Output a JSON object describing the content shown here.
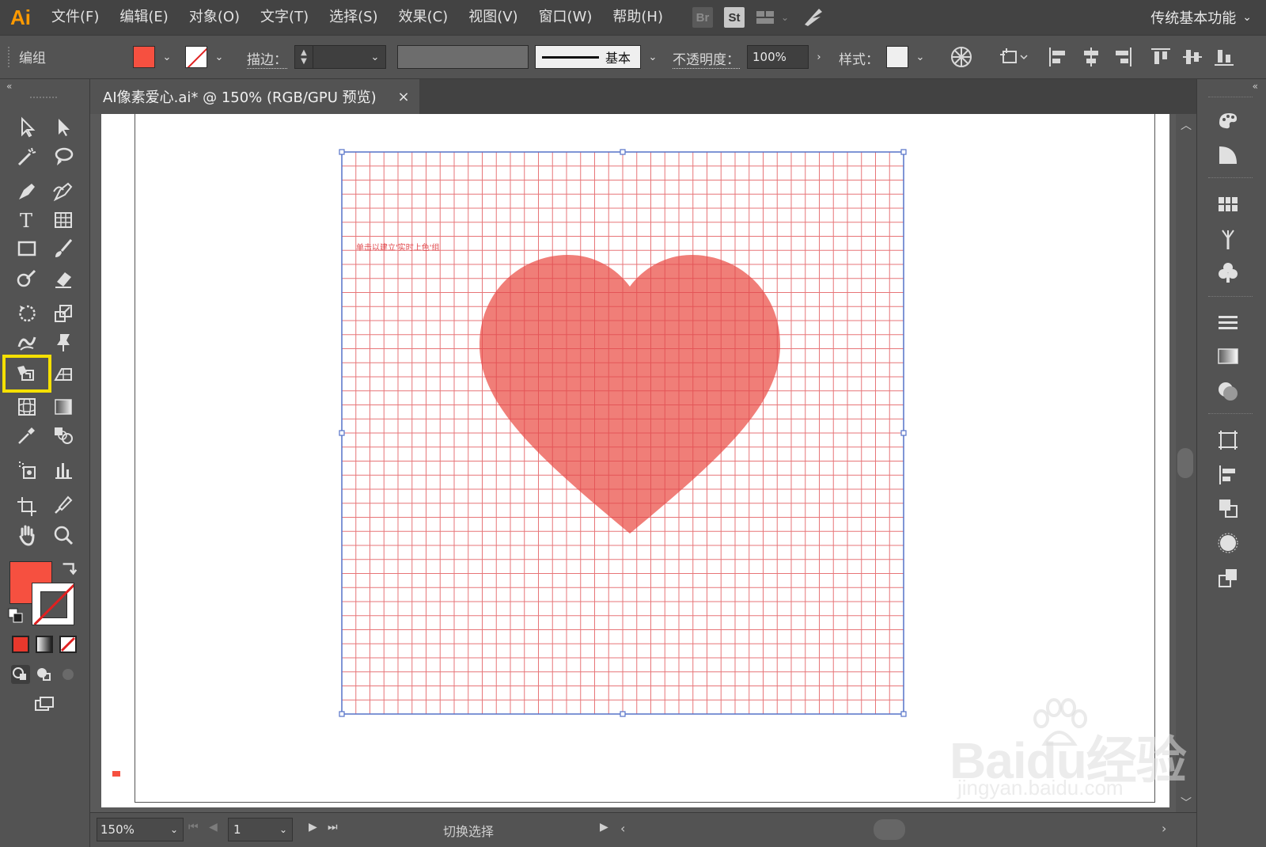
{
  "menubar": {
    "app_logo": "Ai",
    "items": [
      "文件(F)",
      "编辑(E)",
      "对象(O)",
      "文字(T)",
      "选择(S)",
      "效果(C)",
      "视图(V)",
      "窗口(W)",
      "帮助(H)"
    ],
    "bridge_label": "Br",
    "stock_label": "St",
    "workspace_label": "传统基本功能"
  },
  "controlbar": {
    "selection_label": "编组",
    "stroke_label": "描边：",
    "stroke_style_label": "基本",
    "opacity_label": "不透明度：",
    "opacity_value": "100%",
    "style_label": "样式："
  },
  "document": {
    "tab_title": "AI像素爱心.ai* @ 150% (RGB/GPU 预览)",
    "close_glyph": "×",
    "canvas_hint_text": "单击以建立'实时上色'组",
    "heart_color": "#f07e78",
    "grid_color": "#e0484c",
    "selection_color": "#5572c8"
  },
  "colors": {
    "fill": "#f65040",
    "ui_dark": "#535353",
    "menubar": "#434343"
  },
  "statusbar": {
    "zoom_value": "150%",
    "page_value": "1",
    "status_text": "切换选择"
  },
  "watermark": {
    "brand": "Baidu经验",
    "url": "jingyan.baidu.com"
  },
  "tools": {
    "active_tool": "live-paint-bucket-tool"
  }
}
